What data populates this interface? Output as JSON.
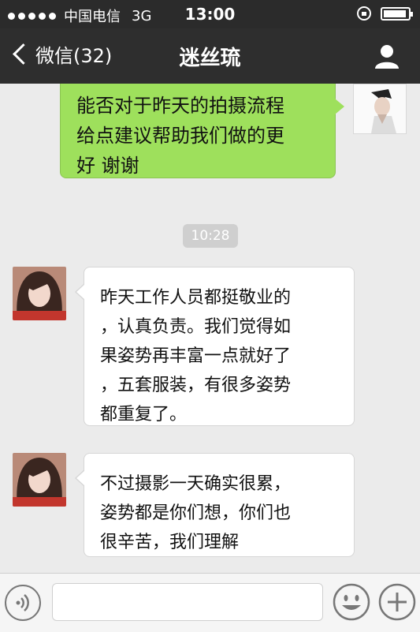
{
  "status_bar": {
    "carrier": "中国电信",
    "network": "3G",
    "time": "13:00"
  },
  "nav": {
    "back_label": "微信(32)",
    "title": "迷丝琉",
    "profile_icon": "person-icon"
  },
  "messages": [
    {
      "sender": "me",
      "lines": [
        "能否对于昨天的拍摄流程",
        "给点建议帮助我们做的更",
        "好 谢谢"
      ]
    },
    {
      "timestamp": "10:28"
    },
    {
      "sender": "her",
      "lines": [
        "昨天工作人员都挺敬业的",
        "，认真负责。我们觉得如",
        "果姿势再丰富一点就好了",
        "，五套服装，有很多姿势",
        "都重复了。"
      ]
    },
    {
      "sender": "her",
      "lines": [
        "不过摄影一天确实很累，",
        "姿势都是你们想，你们也",
        "很辛苦，我们理解"
      ]
    }
  ],
  "input_bar": {
    "text_value": "",
    "voice_icon": "voice-icon",
    "emoji_icon": "emoji-icon",
    "plus_icon": "plus-icon"
  },
  "colors": {
    "bar_bg": "#2e2e2e",
    "sent_bubble": "#9ee05c",
    "chat_bg": "#ebebeb"
  }
}
